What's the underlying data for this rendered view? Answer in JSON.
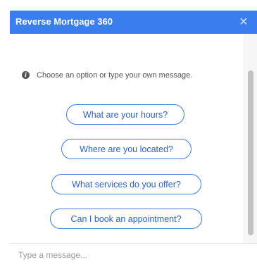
{
  "header": {
    "title": "Reverse Mortgage 360",
    "close_glyph": "×",
    "background_color": "#3b7ef0"
  },
  "conversation": {
    "prompt_icon": "info-icon",
    "prompt_icon_glyph": "i",
    "prompt_text": "Choose an option or type your own message.",
    "options": [
      "What are your hours?",
      "Where are you located?",
      "What services do you offer?",
      "Can I book an appointment?"
    ],
    "option_border_color": "#3f7de0"
  },
  "composer": {
    "placeholder": "Type a message..."
  }
}
